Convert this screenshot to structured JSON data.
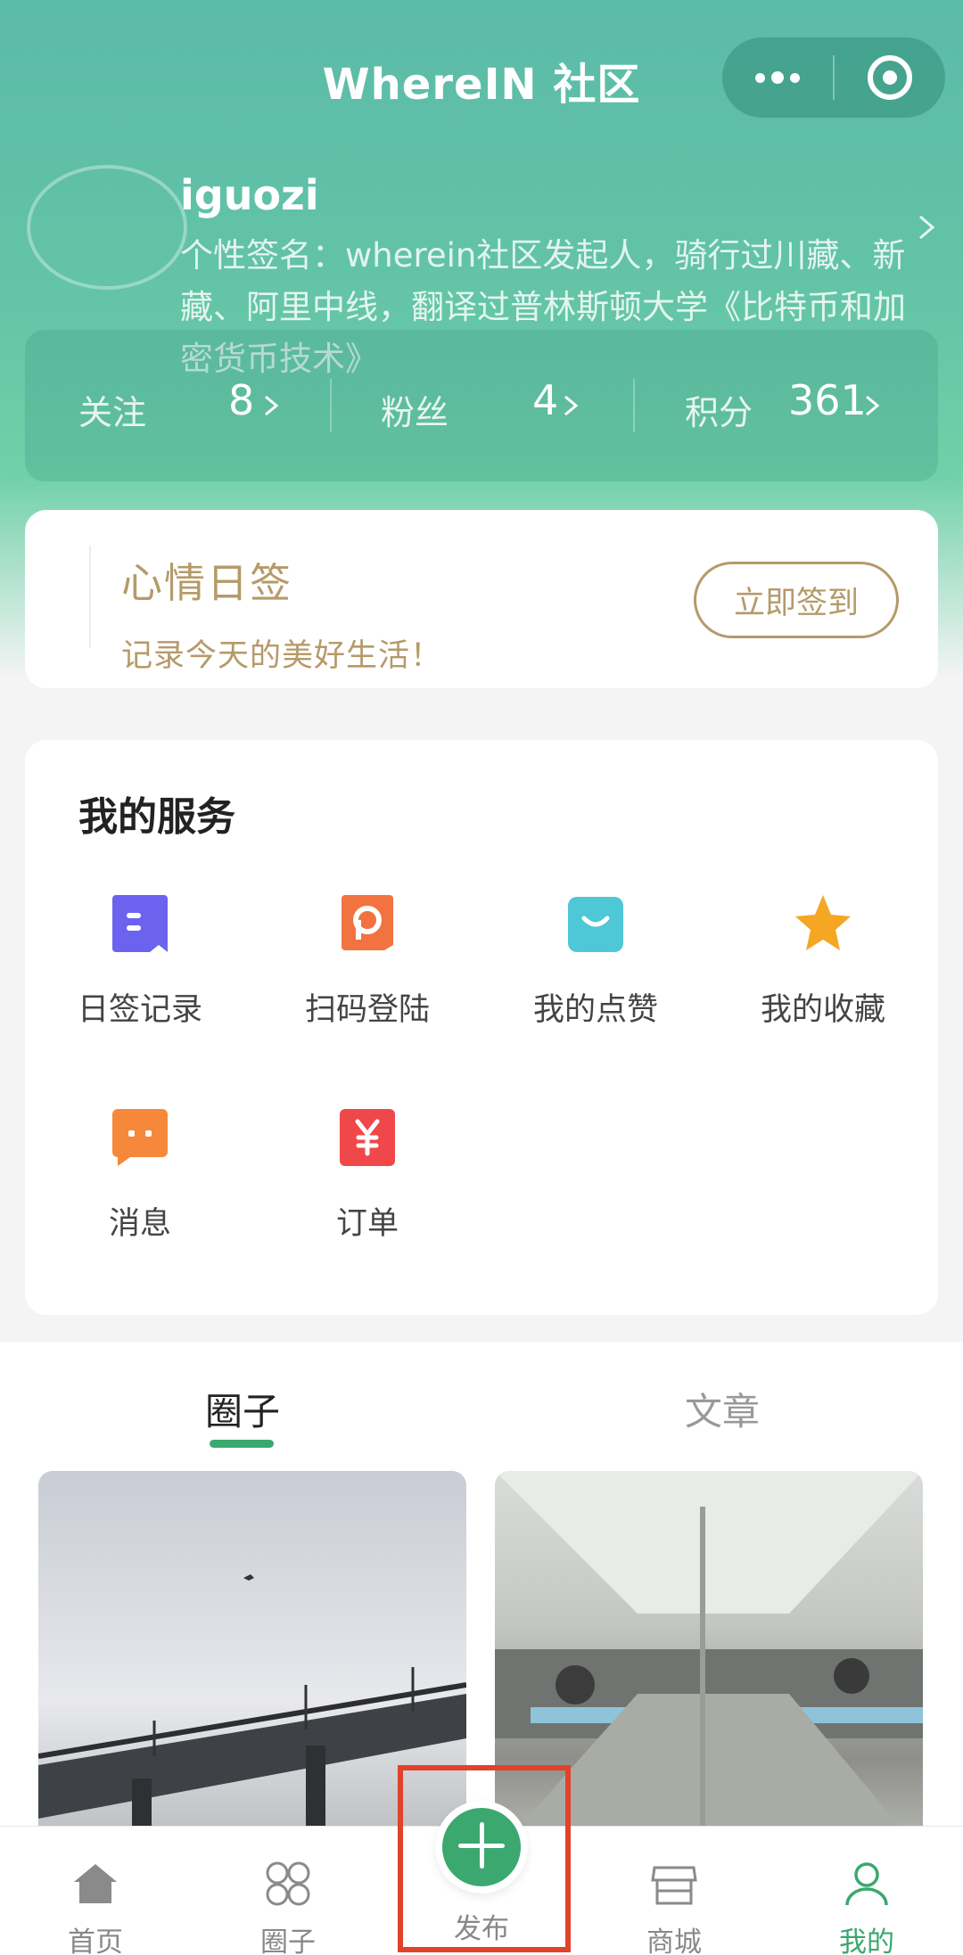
{
  "colors": {
    "accent": "#3aa86f",
    "hero": "#5bbba9",
    "gold": "#b59a6a",
    "highlight": "#e0432a"
  },
  "nav": {
    "title": "WhereIN 社区",
    "more_icon": "more-dots-icon",
    "close_icon": "target-icon"
  },
  "profile": {
    "username": "iguozi",
    "signature": "个性签名：wherein社区发起人，骑行过川藏、新藏、阿里中线，翻译过普林斯顿大学《比特币和加密货币技术》"
  },
  "stats": [
    {
      "label": "关注",
      "value": "8"
    },
    {
      "label": "粉丝",
      "value": "4"
    },
    {
      "label": "积分",
      "value": "361"
    }
  ],
  "checkin": {
    "title": "心情日签",
    "subtitle": "记录今天的美好生活！",
    "button": "立即签到"
  },
  "services": {
    "title": "我的服务",
    "items": [
      {
        "label": "日签记录",
        "icon": "checkin-record-icon",
        "color": "#6b63f0"
      },
      {
        "label": "扫码登陆",
        "icon": "scan-login-icon",
        "color": "#f2733f"
      },
      {
        "label": "我的点赞",
        "icon": "like-bag-icon",
        "color": "#4ec7d6"
      },
      {
        "label": "我的收藏",
        "icon": "star-icon",
        "color": "#f5a623"
      },
      {
        "label": "消息",
        "icon": "message-icon",
        "color": "#f5883a"
      },
      {
        "label": "订单",
        "icon": "order-yen-icon",
        "color": "#f0484a"
      }
    ]
  },
  "content_tabs": [
    {
      "label": "圈子",
      "active": true
    },
    {
      "label": "文章",
      "active": false
    }
  ],
  "tabbar": [
    {
      "label": "首页",
      "icon": "home-icon"
    },
    {
      "label": "圈子",
      "icon": "circles-icon"
    },
    {
      "label": "发布",
      "icon": "plus-icon"
    },
    {
      "label": "商城",
      "icon": "store-icon"
    },
    {
      "label": "我的",
      "icon": "user-icon",
      "active": true
    }
  ]
}
